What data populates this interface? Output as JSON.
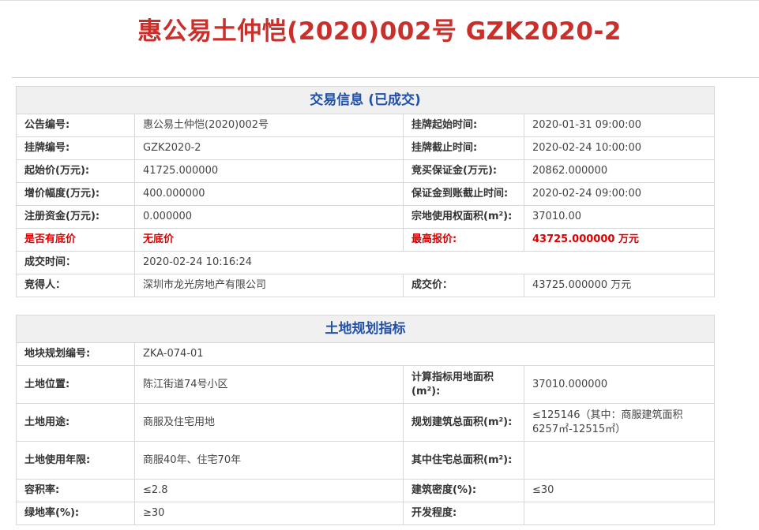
{
  "header": {
    "title": "惠公易土仲恺(2020)002号 GZK2020-2"
  },
  "trade": {
    "section_title": "交易信息 (已成交)",
    "rows": [
      {
        "l1": "公告编号:",
        "v1": "惠公易土仲恺(2020)002号",
        "l2": "挂牌起始时间:",
        "v2": "2020-01-31 09:00:00"
      },
      {
        "l1": "挂牌编号:",
        "v1": "GZK2020-2",
        "l2": "挂牌截止时间:",
        "v2": "2020-02-24 10:00:00"
      },
      {
        "l1": "起始价(万元):",
        "v1": "41725.000000",
        "l2": "竞买保证金(万元):",
        "v2": "20862.000000"
      },
      {
        "l1": "增价幅度(万元):",
        "v1": "400.000000",
        "l2": "保证金到账截止时间:",
        "v2": "2020-02-24 09:00:00"
      },
      {
        "l1": "注册资金(万元):",
        "v1": "0.000000",
        "l2": "宗地使用权面积(m²):",
        "v2": "37010.00"
      },
      {
        "l1": "是否有底价",
        "v1": "无底价",
        "l2": "最高报价:",
        "v2": "43725.000000 万元"
      }
    ],
    "deal_time_label": "成交时间：",
    "deal_time_value": "2020-02-24 10:16:24",
    "winner_label": "竞得人：",
    "winner_value": "深圳市龙光房地产有限公司",
    "deal_price_label": "成交价：",
    "deal_price_value": "43725.000000 万元"
  },
  "plan": {
    "section_title": "土地规划指标",
    "plot_no_label": "地块规划编号:",
    "plot_no_value": "ZKA-074-01",
    "rows": [
      {
        "l1": "土地位置:",
        "v1": "陈江街道74号小区",
        "l2": "计算指标用地面积(m²):",
        "v2": "37010.000000"
      },
      {
        "l1": "土地用途:",
        "v1": "商服及住宅用地",
        "l2": "规划建筑总面积(m²):",
        "v2": "≤125146（其中：商服建筑面积6257㎡-12515㎡）"
      },
      {
        "l1": "土地使用年限:",
        "v1": "商服40年、住宅70年",
        "l2": "其中住宅总面积(m²):",
        "v2": ""
      },
      {
        "l1": "容积率:",
        "v1": "≤2.8",
        "l2": "建筑密度(%):",
        "v2": "≤30"
      },
      {
        "l1": "绿地率(%):",
        "v1": "≥30",
        "l2": "开发程度:",
        "v2": ""
      }
    ]
  }
}
